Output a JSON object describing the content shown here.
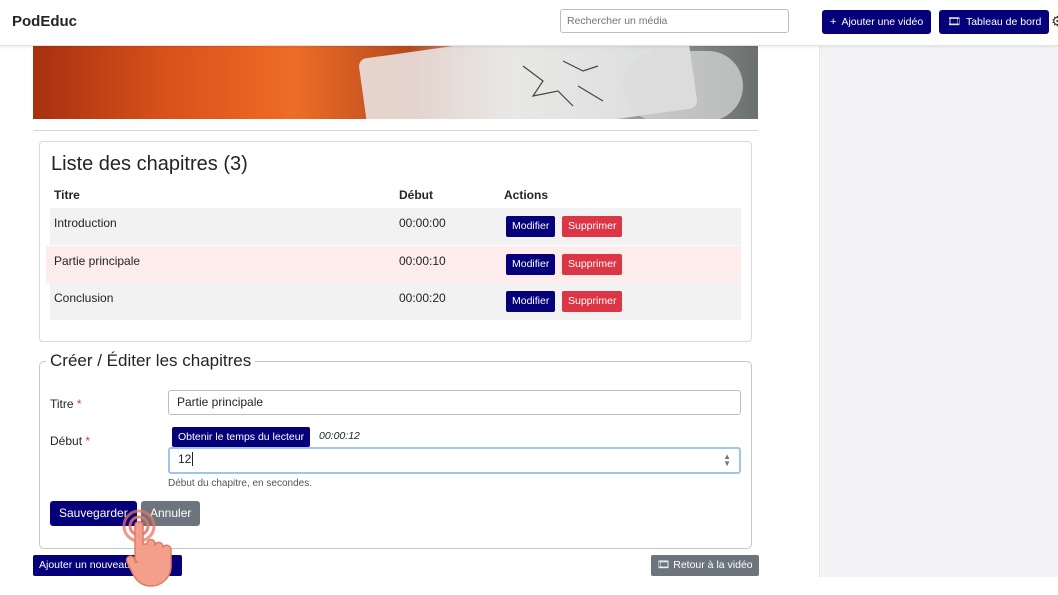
{
  "header": {
    "brand": "PodEduc",
    "search_placeholder": "Rechercher un média",
    "add_video_label": "Ajouter une vidéo",
    "dashboard_label": "Tableau de bord",
    "add_video_icon": "plus-icon",
    "dashboard_icon": "film-icon",
    "settings_icon": "gear-icon"
  },
  "chapters": {
    "title": "Liste des chapitres (3)",
    "columns": [
      "Titre",
      "Début",
      "Actions"
    ],
    "rows": [
      {
        "title": "Introduction",
        "start": "00:00:00",
        "edit": "Modifier",
        "delete": "Supprimer"
      },
      {
        "title": "Partie principale",
        "start": "00:00:10",
        "edit": "Modifier",
        "delete": "Supprimer"
      },
      {
        "title": "Conclusion",
        "start": "00:00:20",
        "edit": "Modifier",
        "delete": "Supprimer"
      }
    ]
  },
  "form": {
    "legend": "Créer / Éditer les chapitres",
    "title_label": "Titre",
    "title_value": "Partie principale",
    "start_label": "Début",
    "required_mark": "*",
    "get_time_button": "Obtenir le temps du lecteur",
    "player_time": "00:00:12",
    "start_value": "12",
    "start_help": "Début du chapitre, en secondes.",
    "save_button": "Sauvegarder",
    "cancel_button": "Annuler"
  },
  "footer": {
    "add_chapter_button": "Ajouter un nouveau",
    "back_button": "Retour à la vidéo",
    "back_icon": "film-icon"
  },
  "colors": {
    "primary": "#05007a",
    "danger": "#dc3545",
    "secondary": "#6c757d",
    "highlight_row": "#fdecec",
    "striped_row": "#f2f2f2"
  }
}
